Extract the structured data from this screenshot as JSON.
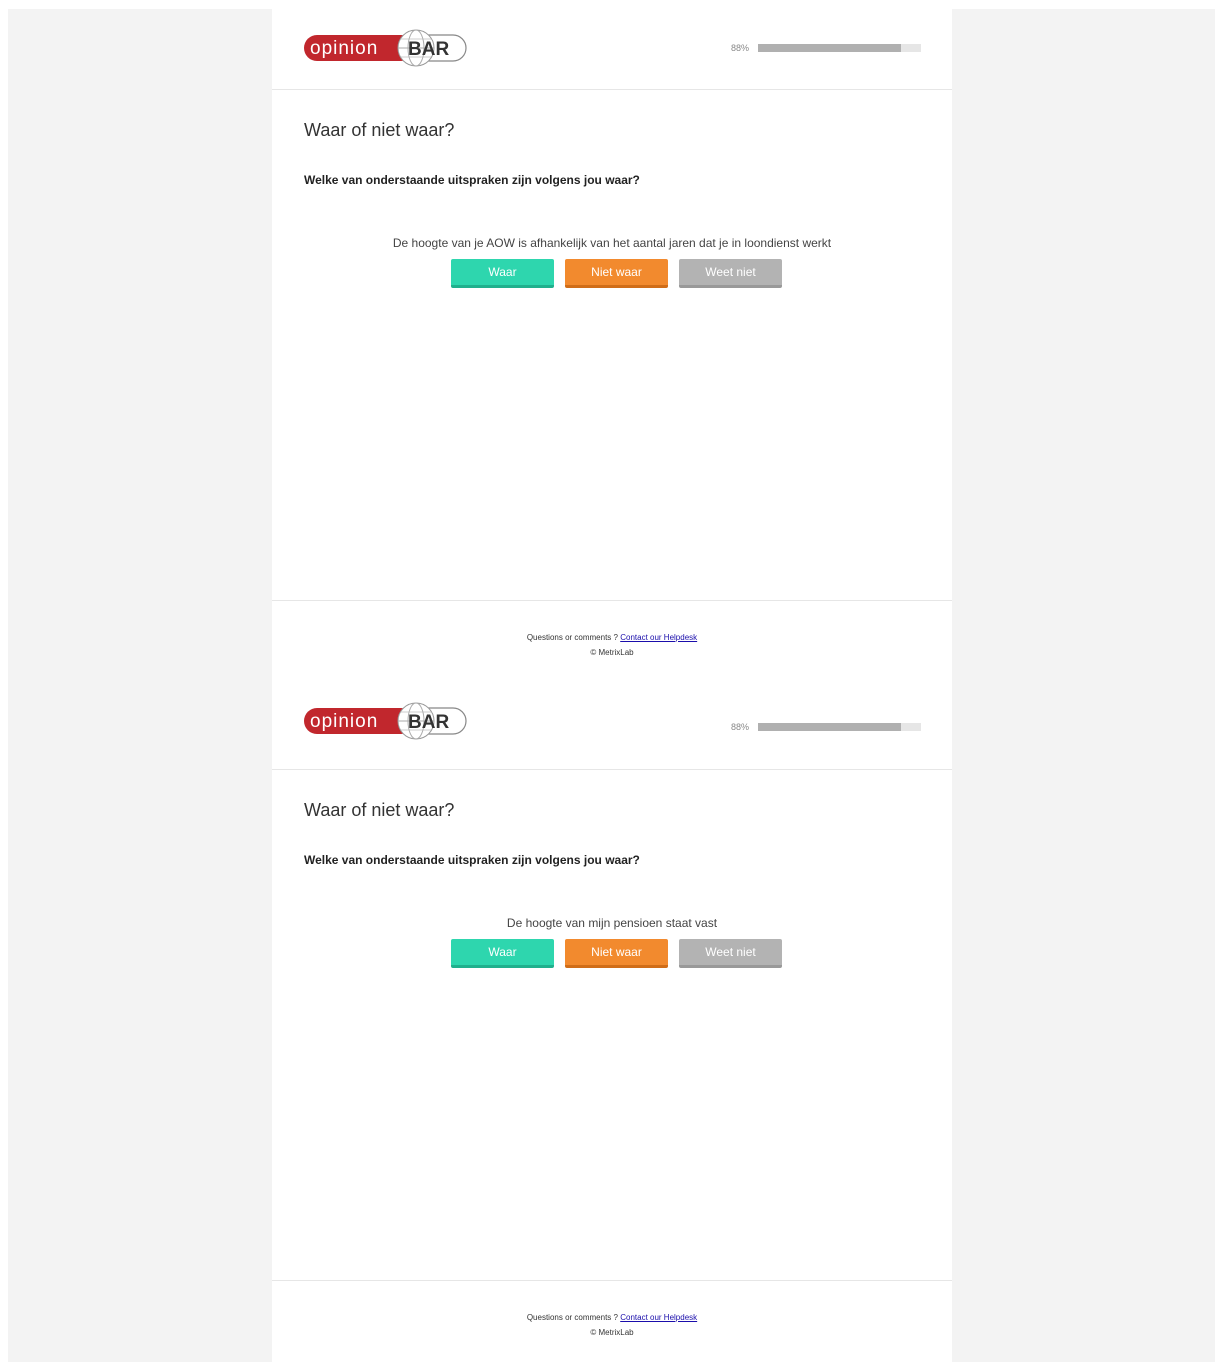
{
  "screens": [
    {
      "brand": {
        "part1": "opinion",
        "part2": "BAR"
      },
      "progress": {
        "label": "88%",
        "value": 0.88
      },
      "page_title": "Waar of niet waar?",
      "question": "Welke van onderstaande uitspraken zijn volgens jou waar?",
      "statement": "De hoogte van je AOW is afhankelijk van het aantal jaren dat je in loondienst werkt",
      "buttons": {
        "true": "Waar",
        "false": "Niet waar",
        "unknown": "Weet niet"
      },
      "footer": {
        "prefix": "Questions or comments ?",
        "link": "Contact our Helpdesk",
        "copyright": "© MetrixLab"
      }
    },
    {
      "brand": {
        "part1": "opinion",
        "part2": "BAR"
      },
      "progress": {
        "label": "88%",
        "value": 0.88
      },
      "page_title": "Waar of niet waar?",
      "question": "Welke van onderstaande uitspraken zijn volgens jou waar?",
      "statement": "De hoogte van mijn pensioen staat vast",
      "buttons": {
        "true": "Waar",
        "false": "Niet waar",
        "unknown": "Weet niet"
      },
      "footer": {
        "prefix": "Questions or comments ?",
        "link": "Contact our Helpdesk",
        "copyright": "© MetrixLab"
      }
    }
  ],
  "colors": {
    "brand_red": "#c1272d",
    "true": "#2ed6ae",
    "false": "#f28a2e",
    "unknown": "#b3b3b3"
  },
  "icons": {
    "logo_globe": "globe-icon"
  }
}
